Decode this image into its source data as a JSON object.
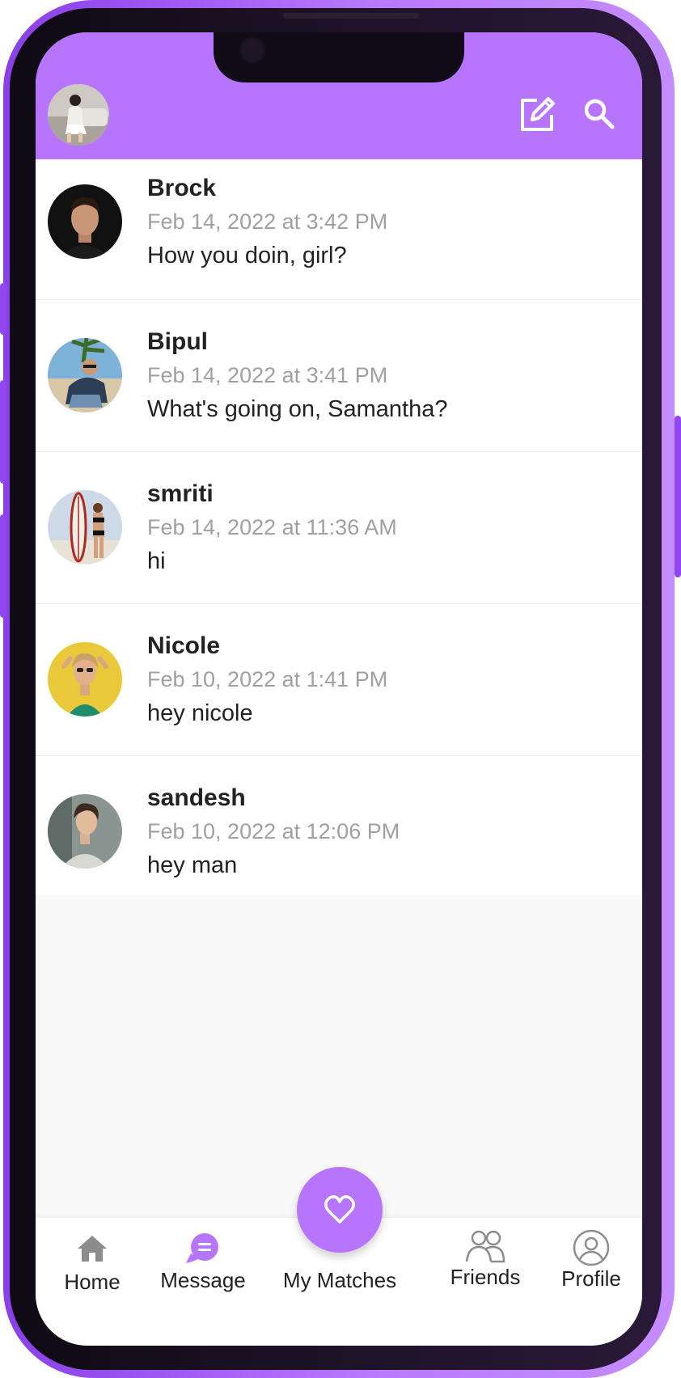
{
  "header": {
    "avatar_icon": "user-avatar",
    "compose_icon": "edit-icon",
    "search_icon": "search-icon"
  },
  "chats": [
    {
      "name": "Brock",
      "time": "Feb 14, 2022 at 3:42 PM",
      "preview": "How you doin, girl?"
    },
    {
      "name": "Bipul",
      "time": "Feb 14, 2022 at 3:41 PM",
      "preview": "What's going on, Samantha?"
    },
    {
      "name": "smriti",
      "time": "Feb 14, 2022 at 11:36 AM",
      "preview": "hi"
    },
    {
      "name": "Nicole",
      "time": "Feb 10, 2022 at 1:41 PM",
      "preview": "hey nicole"
    },
    {
      "name": "sandesh",
      "time": "Feb 10, 2022 at 12:06 PM",
      "preview": "hey man"
    }
  ],
  "tabs": {
    "home": "Home",
    "message": "Message",
    "matches": "My Matches",
    "friends": "Friends",
    "profile": "Profile"
  },
  "colors": {
    "accent": "#b775fd",
    "frame": "#9246ee",
    "inactive_icon": "#8c8c8c",
    "time_text": "#a0a0a0"
  }
}
